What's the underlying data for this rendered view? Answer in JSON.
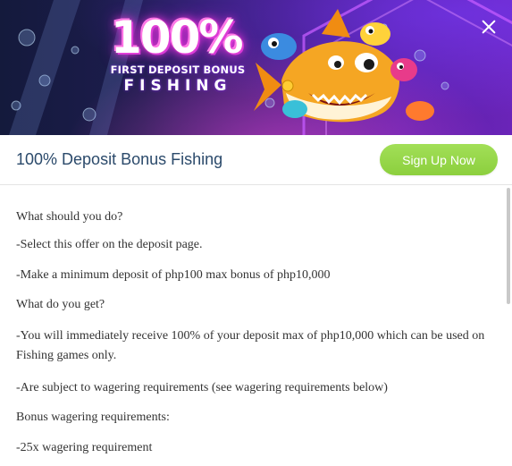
{
  "banner": {
    "headline": "100%",
    "line1": "FIRST DEPOSIT BONUS",
    "line2": "FISHING"
  },
  "header": {
    "title": "100% Deposit Bonus Fishing",
    "signup_label": "Sign Up Now"
  },
  "content": {
    "paragraphs": [
      "What should you do?",
      "-Select this offer on the deposit page.",
      "-Make a minimum deposit of php100 max bonus of php10,000",
      "What do you get?",
      "-You will immediately receive 100% of your deposit max of php10,000 which can be used on Fishing games only.",
      "-Are subject to wagering requirements (see wagering requirements below)",
      "Bonus wagering requirements:",
      "-25x wagering requirement"
    ]
  },
  "colors": {
    "signup_green": "#8ccf3e",
    "title_blue": "#2b4a6b",
    "banner_purple": "#5a20a8"
  },
  "icons": {
    "close": "close-icon"
  }
}
